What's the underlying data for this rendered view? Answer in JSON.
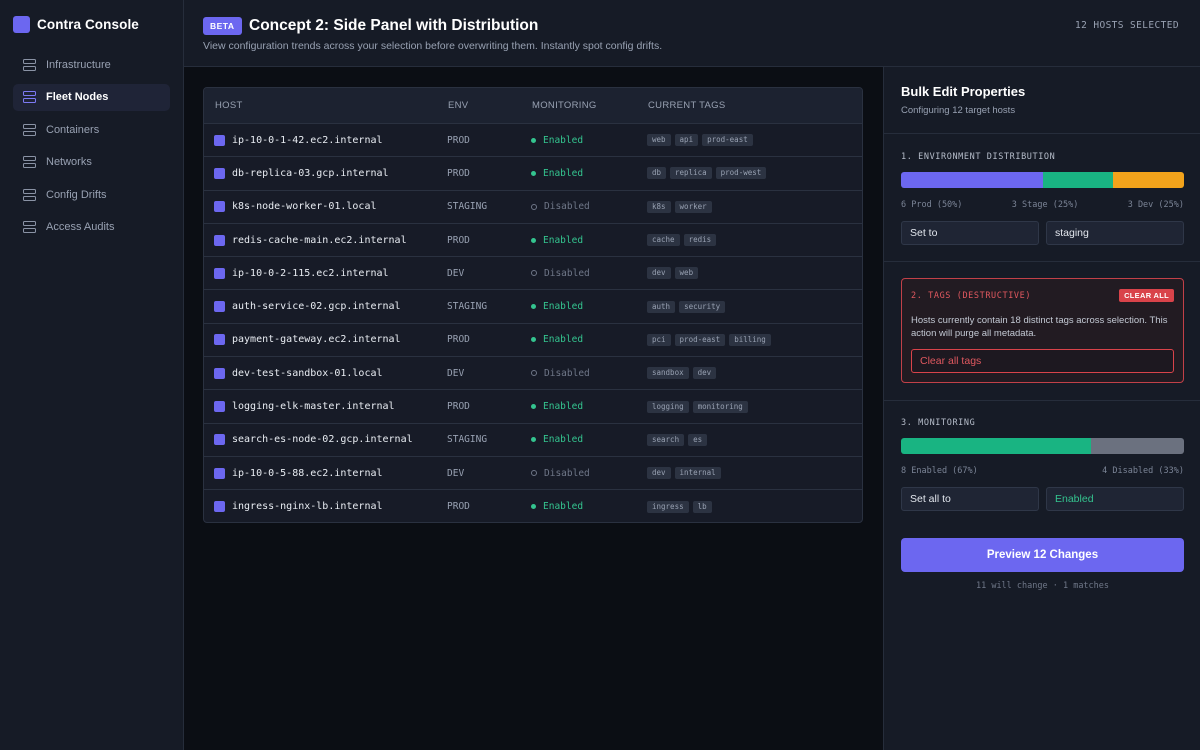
{
  "app": {
    "name": "Contra Console"
  },
  "sidebar": {
    "items": [
      {
        "label": "Infrastructure",
        "active": false
      },
      {
        "label": "Fleet Nodes",
        "active": true
      },
      {
        "label": "Containers",
        "active": false
      },
      {
        "label": "Networks",
        "active": false
      },
      {
        "label": "Config Drifts",
        "active": false
      },
      {
        "label": "Access Audits",
        "active": false
      }
    ]
  },
  "header": {
    "badge": "BETA",
    "title": "Concept 2: Side Panel with Distribution",
    "subtitle": "View configuration trends across your selection before overwriting them. Instantly spot config drifts.",
    "selection_count": "12 HOSTS SELECTED"
  },
  "table": {
    "columns": [
      "HOST",
      "ENV",
      "MONITORING",
      "CURRENT TAGS"
    ],
    "rows": [
      {
        "host": "ip-10-0-1-42.ec2.internal",
        "env": "PROD",
        "monitoring": "Enabled",
        "enabled": true,
        "tags": [
          "web",
          "api",
          "prod-east"
        ]
      },
      {
        "host": "db-replica-03.gcp.internal",
        "env": "PROD",
        "monitoring": "Enabled",
        "enabled": true,
        "tags": [
          "db",
          "replica",
          "prod-west"
        ]
      },
      {
        "host": "k8s-node-worker-01.local",
        "env": "STAGING",
        "monitoring": "Disabled",
        "enabled": false,
        "tags": [
          "k8s",
          "worker"
        ]
      },
      {
        "host": "redis-cache-main.ec2.internal",
        "env": "PROD",
        "monitoring": "Enabled",
        "enabled": true,
        "tags": [
          "cache",
          "redis"
        ]
      },
      {
        "host": "ip-10-0-2-115.ec2.internal",
        "env": "DEV",
        "monitoring": "Disabled",
        "enabled": false,
        "tags": [
          "dev",
          "web"
        ]
      },
      {
        "host": "auth-service-02.gcp.internal",
        "env": "STAGING",
        "monitoring": "Enabled",
        "enabled": true,
        "tags": [
          "auth",
          "security"
        ]
      },
      {
        "host": "payment-gateway.ec2.internal",
        "env": "PROD",
        "monitoring": "Enabled",
        "enabled": true,
        "tags": [
          "pci",
          "prod-east",
          "billing"
        ]
      },
      {
        "host": "dev-test-sandbox-01.local",
        "env": "DEV",
        "monitoring": "Disabled",
        "enabled": false,
        "tags": [
          "sandbox",
          "dev"
        ]
      },
      {
        "host": "logging-elk-master.internal",
        "env": "PROD",
        "monitoring": "Enabled",
        "enabled": true,
        "tags": [
          "logging",
          "monitoring"
        ]
      },
      {
        "host": "search-es-node-02.gcp.internal",
        "env": "STAGING",
        "monitoring": "Enabled",
        "enabled": true,
        "tags": [
          "search",
          "es"
        ]
      },
      {
        "host": "ip-10-0-5-88.ec2.internal",
        "env": "DEV",
        "monitoring": "Disabled",
        "enabled": false,
        "tags": [
          "dev",
          "internal"
        ]
      },
      {
        "host": "ingress-nginx-lb.internal",
        "env": "PROD",
        "monitoring": "Enabled",
        "enabled": true,
        "tags": [
          "ingress",
          "lb"
        ]
      }
    ]
  },
  "panel": {
    "title": "Bulk Edit Properties",
    "subtitle": "Configuring 12 target hosts",
    "environment": {
      "label": "1. ENVIRONMENT DISTRIBUTION",
      "segments": [
        {
          "label": "6 Prod (50%)",
          "fraction": 0.5,
          "color": "#6c67f0"
        },
        {
          "label": "3 Stage (25%)",
          "fraction": 0.25,
          "color": "#19b482"
        },
        {
          "label": "3 Dev (25%)",
          "fraction": 0.25,
          "color": "#f2a31b"
        }
      ],
      "action": "Set to",
      "value": "staging"
    },
    "tags": {
      "label": "2. TAGS (DESTRUCTIVE)",
      "clear_button": "CLEAR ALL",
      "description": "Hosts currently contain 18 distinct tags across selection. This action will purge all metadata.",
      "input_value": "Clear all tags"
    },
    "monitoring": {
      "label": "3. MONITORING",
      "segments": [
        {
          "label": "8 Enabled (67%)",
          "fraction": 0.67,
          "color": "#19b482"
        },
        {
          "label": "4 Disabled (33%)",
          "fraction": 0.33,
          "color": "#6b717f"
        }
      ],
      "action": "Set all to",
      "value": "Enabled"
    },
    "preview_button": "Preview 12 Changes",
    "preview_note": "11 will change · 1 matches"
  }
}
